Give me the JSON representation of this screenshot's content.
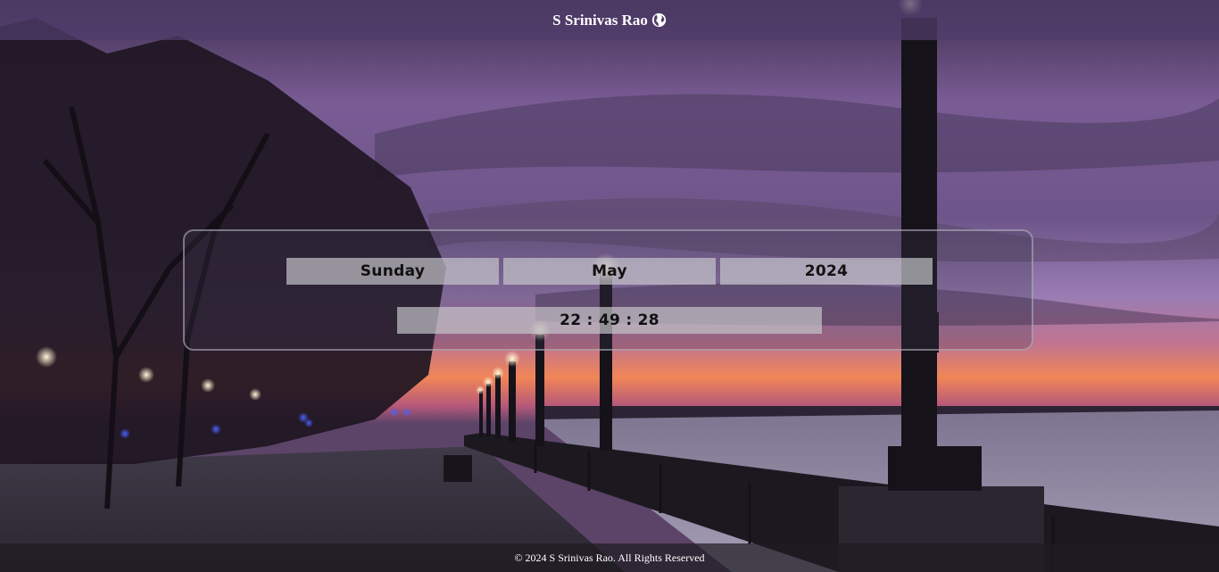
{
  "header": {
    "brand_name": "S Srinivas Rao",
    "brand_icon": "globe-icon"
  },
  "clock": {
    "day": "Sunday",
    "month": "May",
    "year": "2024",
    "time": "22 : 49 : 28"
  },
  "footer": {
    "copyright": "© 2024 S Srinivas Rao. All Rights Reserved"
  },
  "colors": {
    "header_bg": "#503c69",
    "cell_bg": "#c8c8cd",
    "sky_top": "#5a4a80",
    "sky_glow": "#f07a55"
  }
}
